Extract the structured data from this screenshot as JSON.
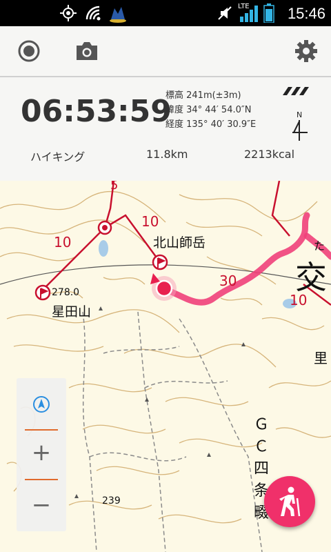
{
  "status_bar": {
    "time": "15:46",
    "network_label": "LTE",
    "icons": [
      "gps-icon",
      "wifi-icon",
      "app-notification-icon",
      "mute-icon",
      "signal-icon",
      "battery-icon"
    ]
  },
  "toolbar": {
    "icons": [
      "record-icon",
      "camera-icon",
      "settings-icon"
    ]
  },
  "info": {
    "elapsed_time": "06:53:59",
    "altitude": "標高 241m(±3m)",
    "latitude": "緯度 34° 44′ 54.0″N",
    "longitude": "経度 135° 40′ 30.9″E",
    "compass_label": "N",
    "activity": "ハイキング",
    "distance": "11.8km",
    "calories": "2213kcal"
  },
  "map": {
    "labels": {
      "peak1": "北山師岳",
      "peak2": "星田山",
      "elev1": "278.0",
      "elev2": "239",
      "c10a": "10",
      "c10b": "10",
      "c10c": "10",
      "c30": "30",
      "c5": "5",
      "big_char": "交",
      "side_char": "里",
      "kana": "た",
      "vertical_text": [
        "Ｇ",
        "Ｃ",
        "四",
        "条",
        "畷"
      ]
    },
    "colors": {
      "track": "#f0407a",
      "route": "#c8102e",
      "contour": "#c8a060",
      "accent": "#f0306a"
    }
  },
  "zoom": {
    "plus": "+",
    "minus": "−"
  }
}
